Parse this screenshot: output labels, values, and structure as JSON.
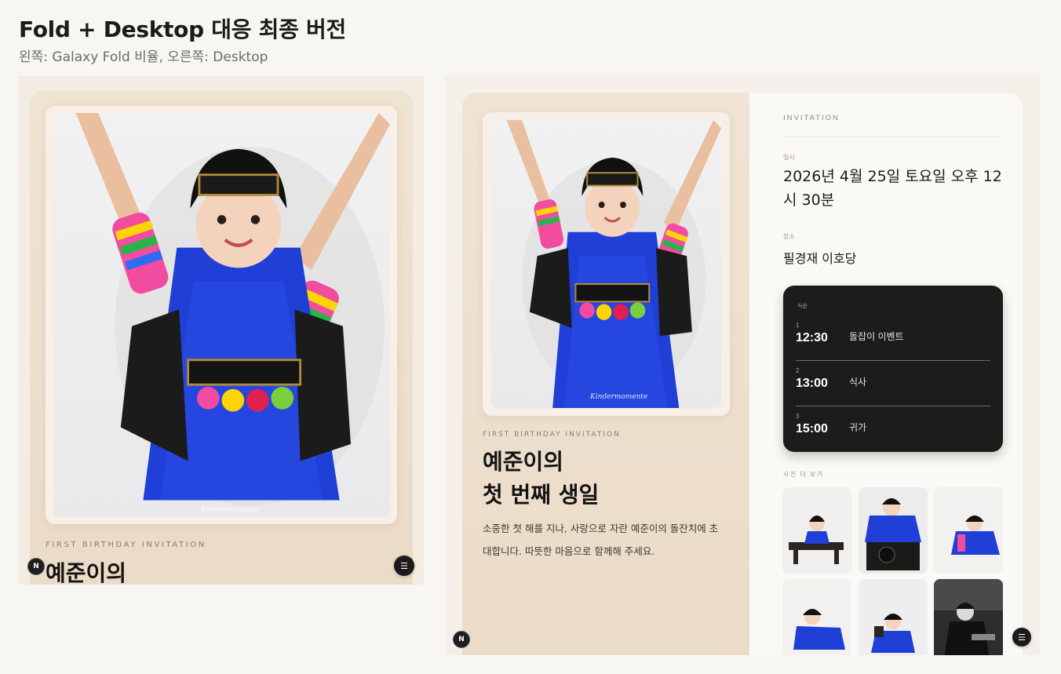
{
  "header": {
    "title": "Fold + Desktop 대응 최종 버전",
    "subtitle": "왼쪽: Galaxy Fold 비율, 오른쪽: Desktop"
  },
  "fold": {
    "eyebrow": "FIRST BIRTHDAY INVITATION",
    "name": "예준이의",
    "watermark": "Kindermomente",
    "badge": "N",
    "menu_icon": "menu-icon"
  },
  "desktop": {
    "eyebrow": "FIRST BIRTHDAY INVITATION",
    "name_line1": "예준이의",
    "name_line2": "첫 번째 생일",
    "intro": "소중한 첫 해를 지나, 사랑으로 자란 예준이의 돌잔치에 초대합니다. 따뜻한 마음으로 함께해 주세요.",
    "watermark": "Kindermomente",
    "badge": "N",
    "details": {
      "eyebrow": "INVITATION",
      "date_label": "일시",
      "date": "2026년 4월 25일 토요일 오후 12시 30분",
      "place_label": "장소",
      "place": "필경재 이호당",
      "schedule_label": "식순",
      "schedule": [
        {
          "index": "1",
          "time": "12:30",
          "event": "돌잡이 이벤트"
        },
        {
          "index": "2",
          "time": "13:00",
          "event": "식사"
        },
        {
          "index": "3",
          "time": "15:00",
          "event": "귀가"
        }
      ],
      "gallery_label": "사진 더 보기"
    }
  },
  "colors": {
    "page_bg": "#f8f6f2",
    "card_beige": "#eadbc6",
    "schedule_bg": "#1d1c1b",
    "hanbok_blue": "#1f3fd6"
  }
}
